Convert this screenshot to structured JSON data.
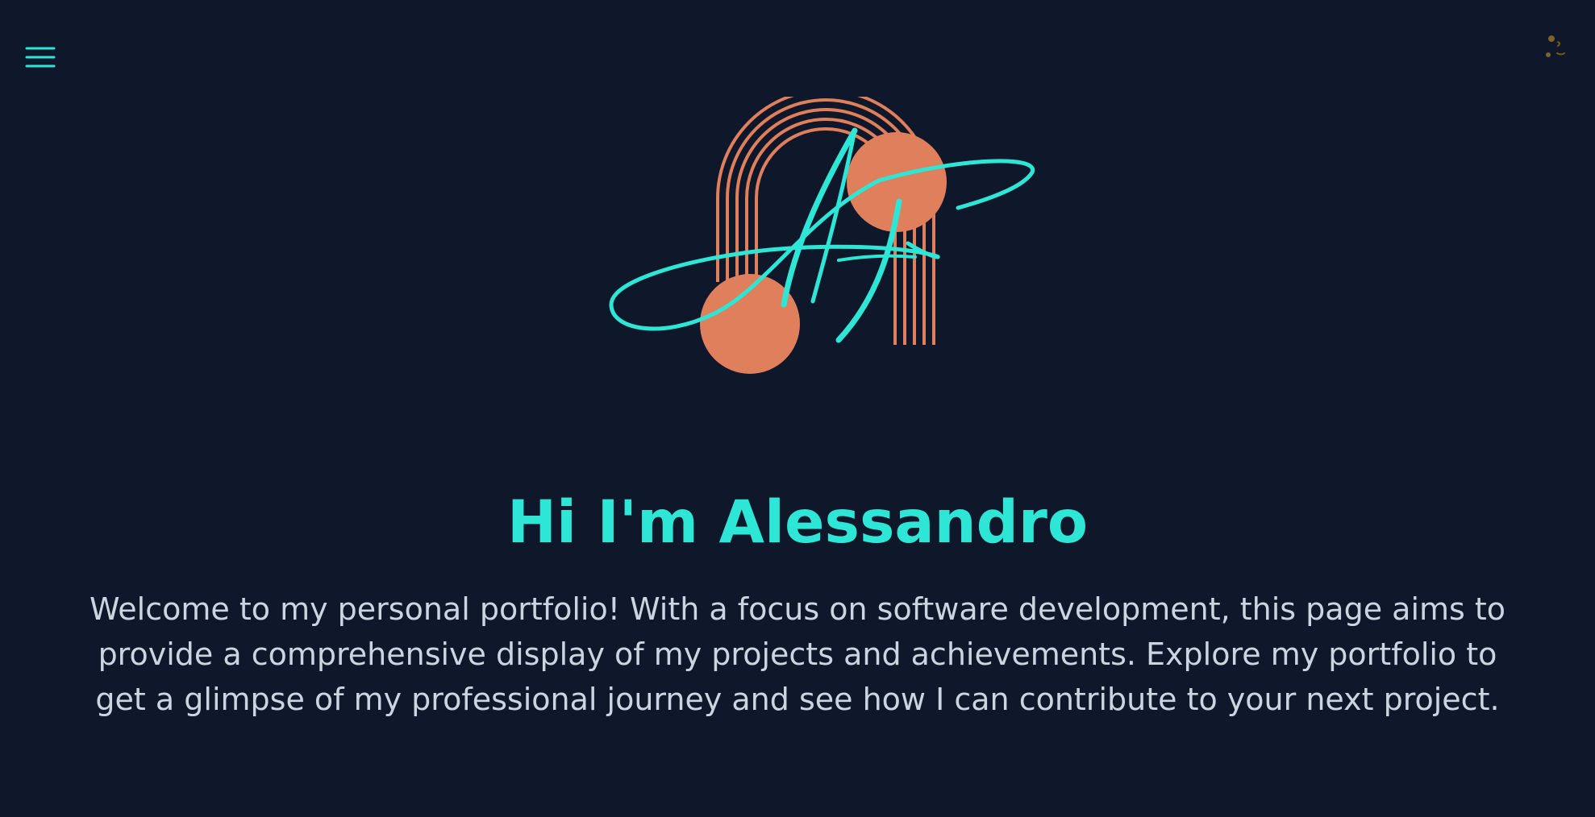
{
  "header": {
    "menu_icon": "hamburger-menu-icon",
    "theme_icon": "first-quarter-moon-face-icon"
  },
  "logo": {
    "icon": "signature-monogram-logo",
    "colors": {
      "arches": "#e07f5c",
      "circles": "#e07f5c",
      "signature": "#2ee6d6"
    }
  },
  "hero": {
    "title": "Hi I'm Alessandro",
    "description": "Welcome to my personal portfolio! With a focus on software development, this page aims to provide a comprehensive display of my projects and achievements. Explore my portfolio to get a glimpse of my professional journey and see how I can contribute to your next project."
  },
  "colors": {
    "background": "#0f172a",
    "accent": "#2ee6d6",
    "text": "#cbd5e1",
    "logo_orange": "#e07f5c"
  }
}
